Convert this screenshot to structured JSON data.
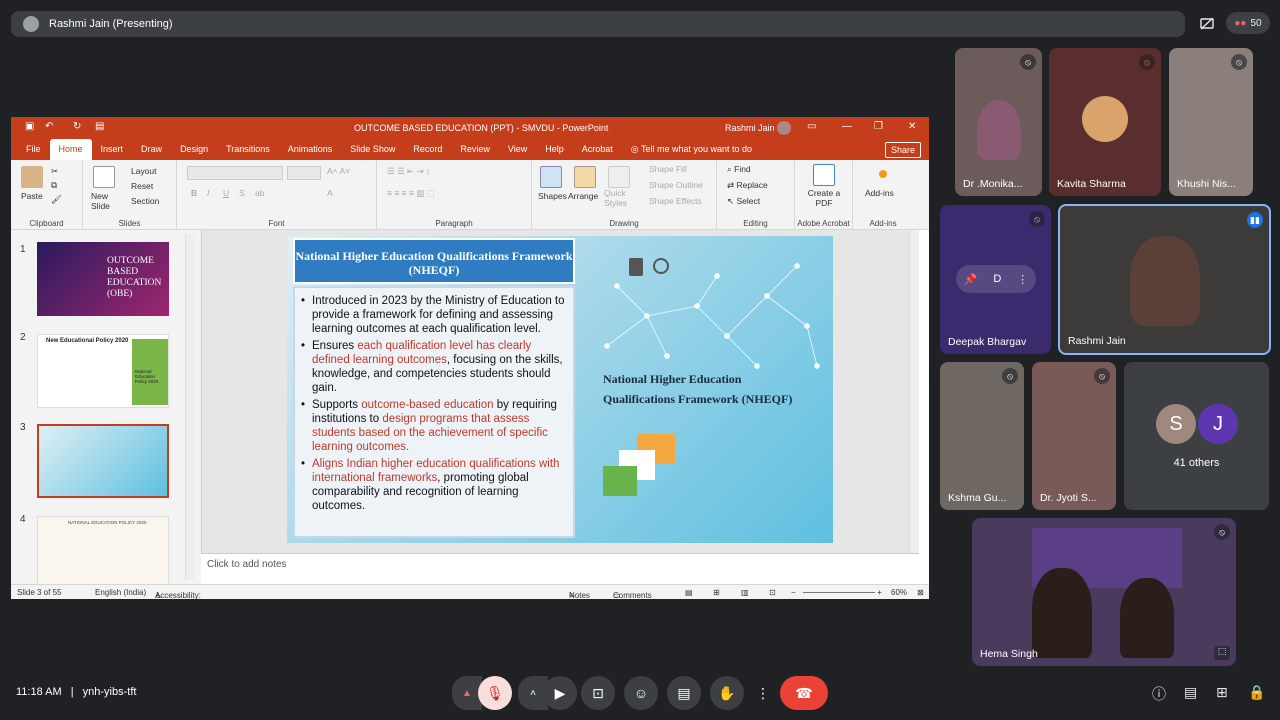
{
  "meet": {
    "presenter_label": "Rashmi Jain (Presenting)",
    "participant_count": "50",
    "time": "11:18 AM",
    "separator": "|",
    "meeting_code": "ynh-yibs-tft"
  },
  "ppt": {
    "window_title": "OUTCOME BASED EDUCATION (PPT) - SMVDU - PowerPoint",
    "user": "Rashmi Jain",
    "tabs": [
      "File",
      "Home",
      "Insert",
      "Draw",
      "Design",
      "Transitions",
      "Animations",
      "Slide Show",
      "Record",
      "Review",
      "View",
      "Help",
      "Acrobat"
    ],
    "tell_me": "Tell me what you want to do",
    "share_label": "Share",
    "ribbon": {
      "paste": "Paste",
      "clipboard": "Clipboard",
      "new_slide": "New Slide",
      "layout": "Layout",
      "reset": "Reset",
      "section": "Section",
      "slides": "Slides",
      "font": "Font",
      "paragraph": "Paragraph",
      "shapes": "Shapes",
      "arrange": "Arrange",
      "quick_styles": "Quick Styles",
      "shape_fill": "Shape Fill",
      "shape_outline": "Shape Outline",
      "shape_effects": "Shape Effects",
      "drawing": "Drawing",
      "find": "Find",
      "replace": "Replace",
      "select": "Select",
      "editing": "Editing",
      "create_pdf": "Create a PDF",
      "adobe": "Adobe Acrobat",
      "addins_btn": "Add-ins",
      "addins": "Add-ins"
    },
    "thumb_numbers": [
      "1",
      "2",
      "3",
      "4"
    ],
    "thumb1_text": "OUTCOME BASED EDUCATION (OBE)",
    "thumb2_title": "New Educational Policy 2020",
    "thumb2_side": "National Education Policy 2020",
    "thumb4_title": "NATIONAL EDUCATION POLICY 2020",
    "slide": {
      "title": "National Higher Education Qualifications Framework (NHEQF)",
      "right_title": "National Higher Education Qualifications Framework (NHEQF)",
      "b1": "Introduced in 2023 by the Ministry of Education to provide a framework for defining and assessing learning outcomes at each qualification level.",
      "b2_a": "Ensures ",
      "b2_red": "each qualification level has clearly defined learning outcomes",
      "b2_b": ", focusing on the skills, knowledge, and competencies students should gain.",
      "b3_a": "Supports ",
      "b3_red1": "outcome-based education",
      "b3_b": " by requiring institutions to ",
      "b3_red2": "design programs that assess students based on the achievement of specific learning outcomes.",
      "b4_red": "Aligns Indian higher education qualifications with international frameworks",
      "b4_b": ", promoting global comparability and recognition of learning outcomes."
    },
    "notes_placeholder": "Click to add notes",
    "status": {
      "slide": "Slide 3 of 55",
      "lang": "English (India)",
      "access": "Accessibility: Good to go",
      "notes": "Notes",
      "comments": "Comments",
      "zoom": "60%"
    }
  },
  "participants": [
    {
      "name": "Dr .Monika..."
    },
    {
      "name": "Kavita Sharma"
    },
    {
      "name": "Khushi Nis..."
    },
    {
      "name": "Deepak Bhargav"
    },
    {
      "name": "Rashmi Jain"
    },
    {
      "name": "Kshma Gu..."
    },
    {
      "name": "Dr. Jyoti S..."
    },
    {
      "name": "Hema Singh"
    }
  ],
  "others": {
    "label": "41 others",
    "a1": "S",
    "a2": "J"
  }
}
